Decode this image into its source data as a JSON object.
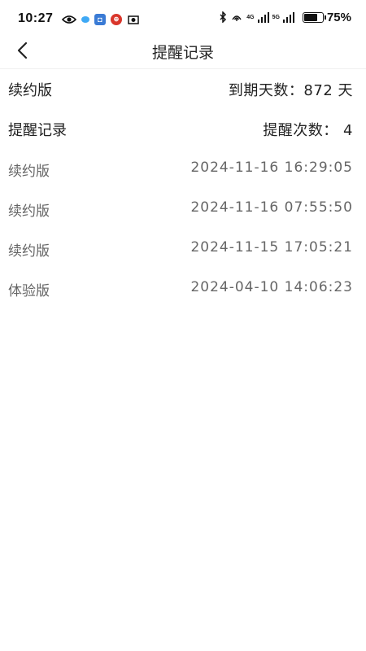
{
  "status_bar": {
    "time": "10:27",
    "net1": "4G",
    "net2": "5G",
    "battery_pct": "75%",
    "battery_level": 0.75
  },
  "header": {
    "title": "提醒记录"
  },
  "summary": {
    "plan_label": "续约版",
    "expire_text": "到期天数：872 天",
    "record_label": "提醒记录",
    "count_text": "提醒次数： 4"
  },
  "records": [
    {
      "type": "续约版",
      "time": "2024-11-16 16:29:05"
    },
    {
      "type": "续约版",
      "time": "2024-11-16 07:55:50"
    },
    {
      "type": "续约版",
      "time": "2024-11-15 17:05:21"
    },
    {
      "type": "体验版",
      "time": "2024-04-10 14:06:23"
    }
  ]
}
